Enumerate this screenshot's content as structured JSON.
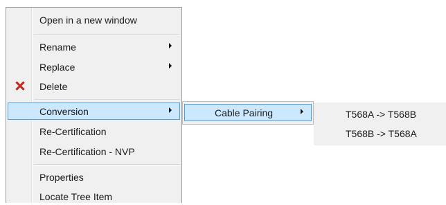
{
  "context_menu": {
    "items": [
      {
        "label": "Open in a new window"
      },
      {
        "label": "Rename"
      },
      {
        "label": "Replace"
      },
      {
        "label": "Delete",
        "icon": "red-x-icon"
      },
      {
        "label": "Conversion"
      },
      {
        "label": "Re-Certification"
      },
      {
        "label": "Re-Certification - NVP"
      },
      {
        "label": "Properties"
      },
      {
        "label": "Locate Tree Item"
      }
    ]
  },
  "submenu_conversion": {
    "items": [
      {
        "label": "Cable Pairing"
      }
    ]
  },
  "submenu_cable_pairing": {
    "items": [
      {
        "label": "T568A -> T568B"
      },
      {
        "label": "T568B -> T568A"
      }
    ]
  },
  "colors": {
    "menu_background": "#f0f0f0",
    "highlight_background": "#cce8ff",
    "highlight_border": "#4a9fe0",
    "delete_icon": "#d9291c"
  }
}
